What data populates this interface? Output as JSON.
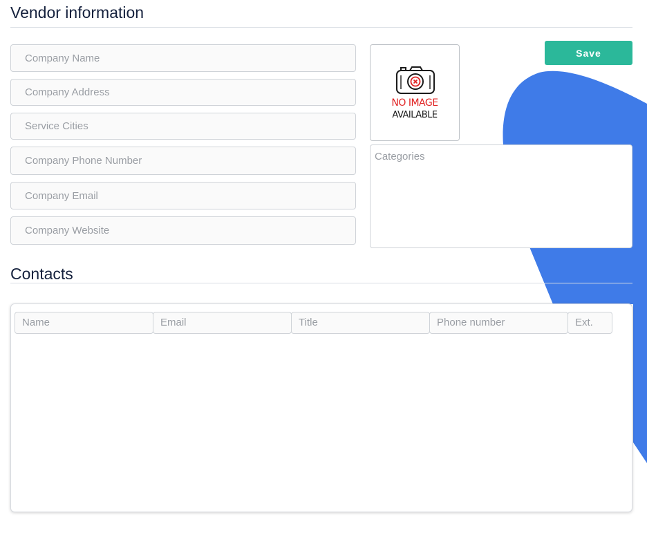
{
  "vendor": {
    "title": "Vendor information",
    "save_label": "Save",
    "fields": {
      "company_name": {
        "placeholder": "Company Name",
        "value": ""
      },
      "company_address": {
        "placeholder": "Company Address",
        "value": ""
      },
      "service_cities": {
        "placeholder": "Service Cities",
        "value": ""
      },
      "company_phone": {
        "placeholder": "Company Phone Number",
        "value": ""
      },
      "company_email": {
        "placeholder": "Company Email",
        "value": ""
      },
      "company_website": {
        "placeholder": "Company Website",
        "value": ""
      }
    },
    "image": {
      "icon": "camera-icon",
      "line1": "NO IMAGE",
      "line2": "AVAILABLE"
    },
    "categories": {
      "placeholder": "Categories",
      "value": ""
    }
  },
  "contacts": {
    "title": "Contacts",
    "columns": [
      "Name",
      "Email",
      "Title",
      "Phone number",
      "Ext."
    ]
  },
  "colors": {
    "accent_save": "#2bb89a",
    "blob": "#3f7be8",
    "heading": "#15213d",
    "no_image_red": "#e02222"
  }
}
